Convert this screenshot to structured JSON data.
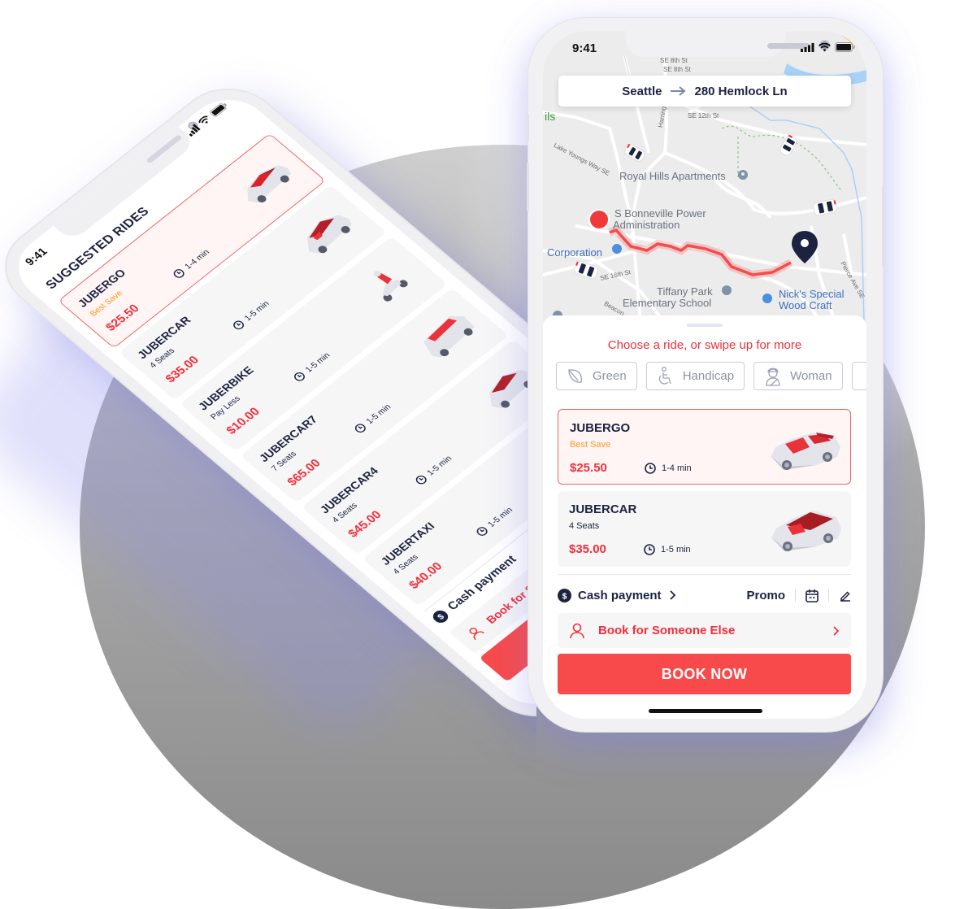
{
  "colors": {
    "accent": "#f84a4a",
    "price": "#f0303a",
    "best_save": "#f39a1e",
    "navy": "#1c2340",
    "selected_bg": "#fff5f5",
    "selected_border": "#ef6565",
    "card_bg": "#f6f6f7",
    "route": "#f44b4b"
  },
  "left_phone": {
    "status": {
      "time": "9:41",
      "icons": [
        "signal-icon",
        "wifi-icon",
        "battery-icon"
      ]
    },
    "title": "SUGGESTED RIDES",
    "rides": [
      {
        "name": "JUBERGO",
        "subtitle": "Best Save",
        "price": "$25.50",
        "eta": "1-4 min",
        "selected": true,
        "vehicle": "car-icon"
      },
      {
        "name": "JUBERCAR",
        "subtitle": "4 Seats",
        "price": "$35.00",
        "eta": "1-5 min",
        "selected": false,
        "vehicle": "car-icon"
      },
      {
        "name": "JUBERBIKE",
        "subtitle": "Pay Less",
        "price": "$10.00",
        "eta": "1-5 min",
        "selected": false,
        "vehicle": "scooter-icon"
      },
      {
        "name": "JUBERCAR7",
        "subtitle": "7 Seats",
        "price": "$65.00",
        "eta": "1-5 min",
        "selected": false,
        "vehicle": "van-icon"
      },
      {
        "name": "JUBERCAR4",
        "subtitle": "4 Seats",
        "price": "$45.00",
        "eta": "1-5 min",
        "selected": false,
        "vehicle": "car-icon"
      },
      {
        "name": "JUBERTAXI",
        "subtitle": "4 Seats",
        "price": "$40.00",
        "eta": "1-5 min",
        "selected": false,
        "vehicle": "car-icon"
      }
    ],
    "payment": "Cash payment",
    "book_for_someone": "Book for Someone Else"
  },
  "right_phone": {
    "status": {
      "time": "9:41",
      "icons": [
        "signal-icon",
        "wifi-icon",
        "battery-icon"
      ]
    },
    "route": {
      "from": "Seattle",
      "to": "280 Hemlock Ln"
    },
    "map_labels": {
      "se8_1": "SE 8th St",
      "se8_2": "SE 8th St",
      "se12": "SE 12th St",
      "harrington": "Harrington Pl",
      "se_ave": "SE",
      "ils": "ils",
      "lake_youngs": "Lake Youngs Way SE",
      "royal_hills": "Royal Hills Apartments",
      "bonneville_1": "S Bonneville Power",
      "bonneville_2": "Administration",
      "corporation": "Corporation",
      "se16": "SE 16th St",
      "tiffany_1": "Tiffany Park",
      "tiffany_2": "Elementary School",
      "nicks_1": "Nick's Special",
      "nicks_2": "Wood Craft",
      "pierce": "Pierce Ave SE",
      "beacon": "Beacon"
    },
    "prompt": "Choose a ride, or swipe up for more",
    "filters": [
      {
        "label": "Green",
        "icon": "leaf-icon"
      },
      {
        "label": "Handicap",
        "icon": "wheelchair-icon"
      },
      {
        "label": "Woman",
        "icon": "woman-driver-icon"
      }
    ],
    "rides": [
      {
        "name": "JUBERGO",
        "subtitle": "Best Save",
        "price": "$25.50",
        "eta": "1-4 min",
        "selected": true
      },
      {
        "name": "JUBERCAR",
        "subtitle": "4 Seats",
        "price": "$35.00",
        "eta": "1-5 min",
        "selected": false
      }
    ],
    "payment": {
      "label": "Cash payment",
      "promo": "Promo"
    },
    "book_for_someone": "Book for Someone Else",
    "book_now": "BOOK NOW"
  }
}
